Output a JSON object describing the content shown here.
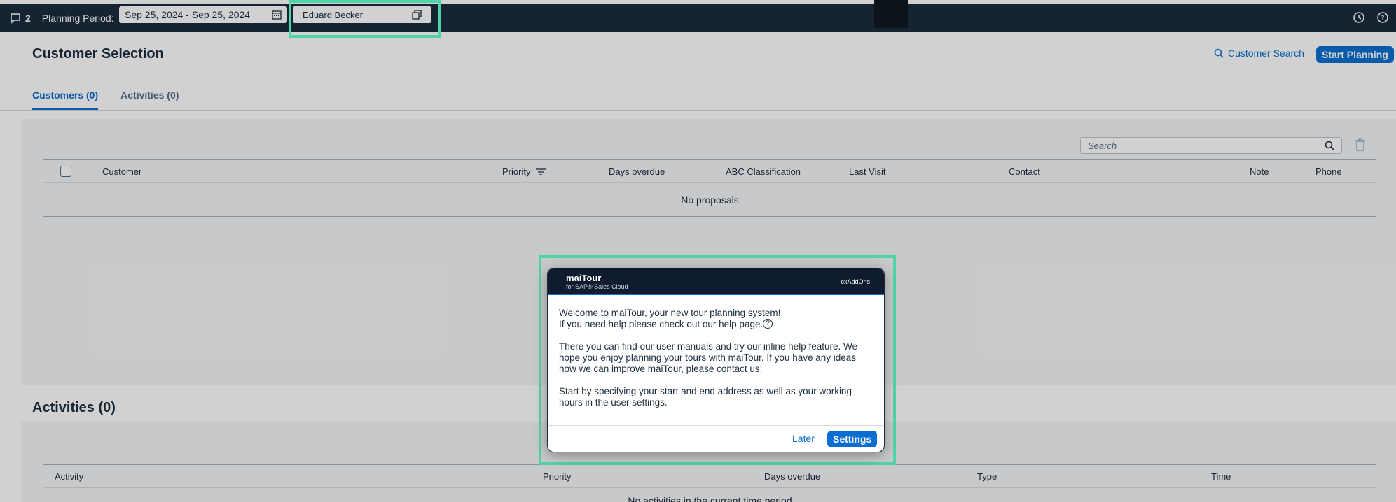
{
  "topbar": {
    "notif_count": "2",
    "planning_label": "Planning Period:",
    "period_value": "Sep 25, 2024 - Sep 25, 2024",
    "user_value": "Eduard Becker"
  },
  "header": {
    "title": "Customer Selection",
    "customer_search": "Customer Search",
    "start_planning": "Start Planning"
  },
  "tabs": [
    {
      "label": "Customers (0)"
    },
    {
      "label": "Activities (0)"
    }
  ],
  "customers_table": {
    "search_placeholder": "Search",
    "columns": [
      "Customer",
      "Priority",
      "Days overdue",
      "ABC Classification",
      "Last Visit",
      "Contact",
      "Note",
      "Phone"
    ],
    "empty_text": "No proposals"
  },
  "activities": {
    "title": "Activities (0)",
    "columns": [
      "Activity",
      "Priority",
      "Days overdue",
      "Type",
      "Time"
    ],
    "empty_text": "No activities in the current time period"
  },
  "dialog": {
    "brand": "maiTour",
    "brand_sub": "for SAP® Sales Cloud",
    "cx": "cxAddOns",
    "line1": "Welcome to maiTour, your new tour planning system!",
    "line2": "If you need help please check out our help page.",
    "para2": "There you can find our user manuals and try our inline help feature. We hope you enjoy planning your tours with maiTour. If you have any ideas how we can improve maiTour, please contact us!",
    "para3": "Start by specifying your start and end address as well as your working hours in the user settings.",
    "later": "Later",
    "settings": "Settings"
  },
  "colors": {
    "shell": "#1b2c3d",
    "accent": "#0a6ed1",
    "highlight": "#4fd4a8"
  }
}
